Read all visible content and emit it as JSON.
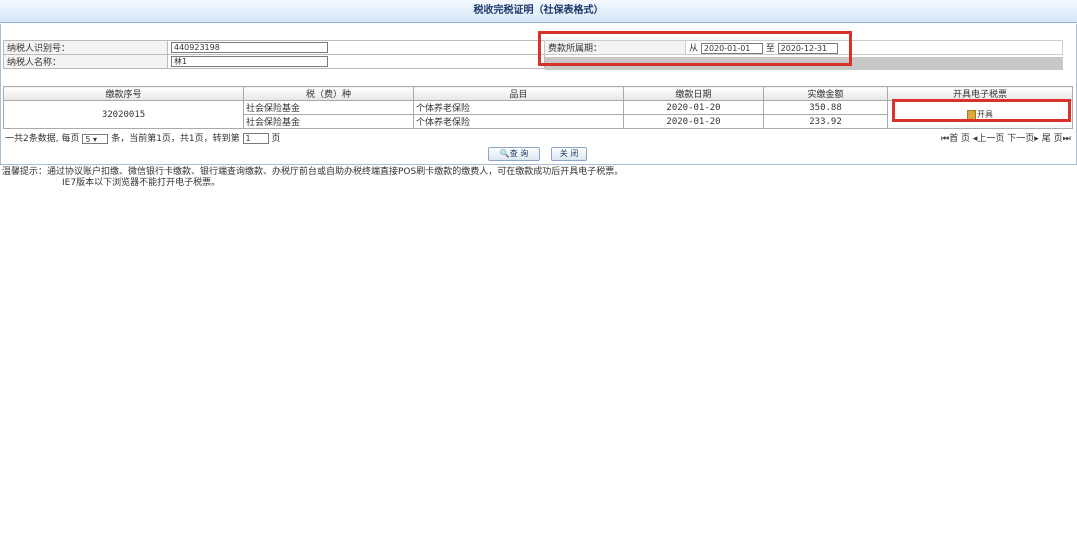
{
  "title": "税收完税证明（社保表格式）",
  "taxpayer": {
    "id_label": "纳税人识别号：",
    "id_value": "440923198",
    "name_label": "纳税人名称：",
    "name_value": "林1"
  },
  "period": {
    "label": "费款所属期：",
    "from_label": "从",
    "from_value": "2020-01-01",
    "to_label": "至",
    "to_value": "2020-12-31"
  },
  "table": {
    "headers": [
      "缴款序号",
      "税（费）种",
      "品目",
      "缴款日期",
      "实缴金额",
      "开具电子税票"
    ],
    "serial": "32020015",
    "rows": [
      {
        "tax_type": "社会保险基金",
        "item": "个体养老保险",
        "date": "2020-01-20",
        "amount": "350.88"
      },
      {
        "tax_type": "社会保险基金",
        "item": "个体养老保险",
        "date": "2020-01-20",
        "amount": "233.92"
      }
    ],
    "issue_label": "开具"
  },
  "pager": {
    "prefix": "一共2条数据, 每页",
    "page_size": "5",
    "mid": "条，当前第1页，共1页，转到第",
    "goto_value": "1",
    "suffix": "页",
    "first": "首 页",
    "prev": "上一页",
    "next": "下一页",
    "last": "尾 页"
  },
  "buttons": {
    "query": "查 询",
    "close": "关 闭"
  },
  "tips": {
    "line1": "温馨提示：通过协议账户扣缴、微信银行卡缴款、银行端查询缴款、办税厅前台或自助办税终端直接POS刷卡缴款的缴费人，可在缴款成功后开具电子税票。",
    "line2": "IE7版本以下浏览器不能打开电子税票。"
  },
  "colors": {
    "highlight": "#d9322a",
    "accent": "#1f3a6b"
  }
}
